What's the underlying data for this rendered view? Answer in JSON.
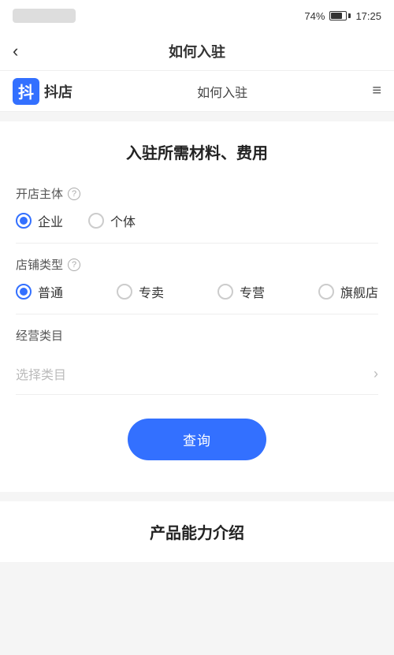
{
  "statusBar": {
    "battery": "74%",
    "time": "17:25"
  },
  "navBar": {
    "backIcon": "‹",
    "title": "如何入驻"
  },
  "brandBar": {
    "logoAlt": "抖店",
    "brandName": "抖店",
    "subtitle": "如何入驻",
    "menuIcon": "≡"
  },
  "mainCard": {
    "sectionTitle": "入驻所需材料、费用",
    "shopOwner": {
      "label": "开店主体",
      "helpIcon": "?",
      "options": [
        {
          "id": "enterprise",
          "label": "企业",
          "checked": true
        },
        {
          "id": "individual",
          "label": "个体",
          "checked": false
        }
      ]
    },
    "shopType": {
      "label": "店铺类型",
      "helpIcon": "?",
      "options": [
        {
          "id": "normal",
          "label": "普通",
          "checked": true
        },
        {
          "id": "exclusive",
          "label": "专卖",
          "checked": false
        },
        {
          "id": "specialty",
          "label": "专营",
          "checked": false
        },
        {
          "id": "flagship",
          "label": "旗舰店",
          "checked": false
        }
      ]
    },
    "businessCategory": {
      "label": "经营类目",
      "placeholder": "选择类目",
      "chevron": "›"
    },
    "queryButton": {
      "label": "查询"
    }
  },
  "bottomSection": {
    "title": "产品能力介绍"
  }
}
